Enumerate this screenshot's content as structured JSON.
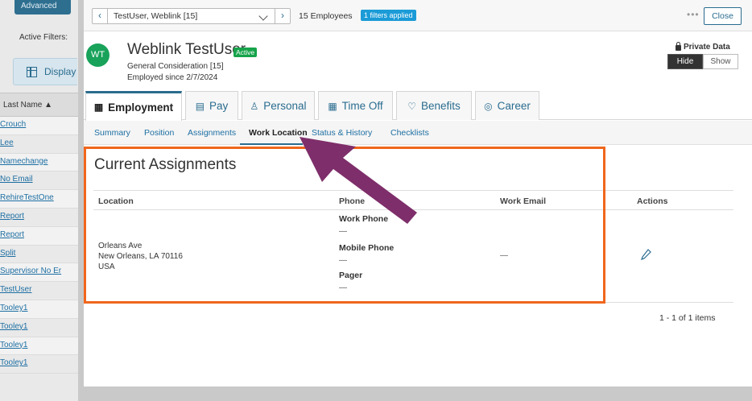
{
  "list_panel": {
    "advanced_label": "Advanced",
    "active_filters_label": "Active Filters:",
    "display_label": "Display",
    "last_name_header": "Last Name ▲",
    "names": [
      "Crouch",
      "Lee",
      "Namechange",
      "No Email",
      "RehireTestOne",
      "Report",
      "Report",
      "Split",
      "Supervisor No Er",
      "TestUser",
      "Tooley1",
      "Tooley1",
      "Tooley1",
      "Tooley1"
    ]
  },
  "topbar": {
    "employee_select": "TestUser, Weblink [15]",
    "employee_count": "15 Employees",
    "filters_badge": "1 filters applied",
    "more_label": "•••",
    "close_label": "Close"
  },
  "employee": {
    "initials": "WT",
    "name": "Weblink TestUser",
    "status_badge": "Active",
    "group": "General Consideration [15]",
    "employed_since": "Employed since 2/7/2024"
  },
  "private_data": {
    "label": "Private Data",
    "hide_label": "Hide",
    "show_label": "Show"
  },
  "main_tabs": [
    {
      "label": "Employment",
      "icon": "building-icon",
      "glyph": "▦"
    },
    {
      "label": "Pay",
      "icon": "pay-icon",
      "glyph": "▤"
    },
    {
      "label": "Personal",
      "icon": "person-icon",
      "glyph": "♙"
    },
    {
      "label": "Time Off",
      "icon": "calendar-icon",
      "glyph": "▦"
    },
    {
      "label": "Benefits",
      "icon": "heart-icon",
      "glyph": "♡"
    },
    {
      "label": "Career",
      "icon": "target-icon",
      "glyph": "◎"
    }
  ],
  "sub_tabs": [
    "Summary",
    "Position",
    "Assignments",
    "Work Location",
    "Status & History",
    "Checklists"
  ],
  "section": {
    "title": "Current Assignments",
    "columns": {
      "location": "Location",
      "phone": "Phone",
      "work_email": "Work Email",
      "actions": "Actions"
    },
    "row": {
      "address_line1": "Orleans Ave",
      "address_line2": "New Orleans, LA 70116",
      "address_line3": "USA",
      "work_phone_label": "Work Phone",
      "work_phone_value": "—",
      "mobile_phone_label": "Mobile Phone",
      "mobile_phone_value": "—",
      "pager_label": "Pager",
      "pager_value": "—",
      "work_email_value": "—"
    },
    "paging": "1 - 1 of 1 items"
  },
  "colors": {
    "accent": "#2a6c8f",
    "active_green": "#16a34a",
    "filter_badge": "#1b9bd7",
    "highlight_orange": "#f0661c",
    "arrow_purple": "#7e2e6a"
  }
}
